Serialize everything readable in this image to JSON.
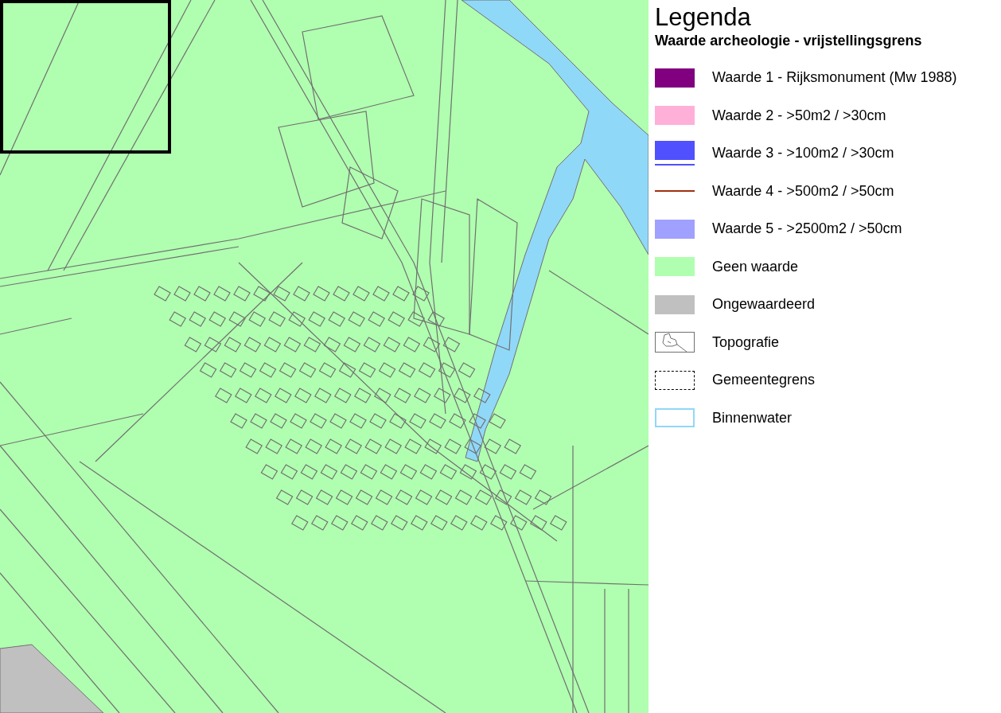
{
  "legend": {
    "title": "Legenda",
    "subtitle": "Waarde archeologie - vrijstellingsgrens",
    "items": [
      {
        "kind": "fill",
        "color": "#800080",
        "label": "Waarde 1 - Rijksmonument (Mw 1988)"
      },
      {
        "kind": "fill",
        "color": "#ffb0d8",
        "label": "Waarde 2 - >50m2 / >30cm"
      },
      {
        "kind": "fill-line",
        "color": "#5050ff",
        "label": "Waarde 3 - >100m2 / >30cm"
      },
      {
        "kind": "line",
        "color": "#a03010",
        "label": "Waarde 4 - >500m2 / >50cm"
      },
      {
        "kind": "fill",
        "color": "#a0a0ff",
        "label": "Waarde 5 - >2500m2 / >50cm"
      },
      {
        "kind": "fill",
        "color": "#b0ffb0",
        "label": "Geen waarde"
      },
      {
        "kind": "fill",
        "color": "#c0c0c0",
        "label": "Ongewaardeerd"
      },
      {
        "kind": "topo",
        "color": "#707070",
        "label": "Topografie"
      },
      {
        "kind": "dashed",
        "color": "#000000",
        "label": "Gemeentegrens"
      },
      {
        "kind": "outline",
        "color": "#90d8f8",
        "label": "Binnenwater"
      }
    ]
  }
}
